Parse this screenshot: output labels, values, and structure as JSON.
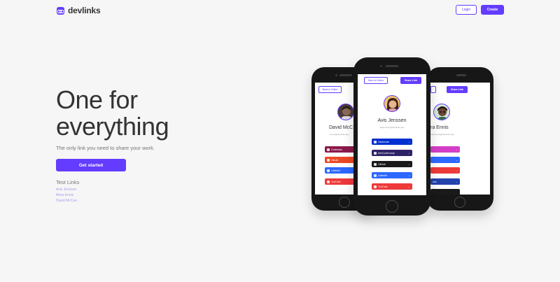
{
  "header": {
    "logo_text": "devlinks",
    "login_label": "Login",
    "create_label": "Create"
  },
  "hero": {
    "title": "One for everything",
    "subtitle": "The only link you need to share your work.",
    "cta_label": "Get started"
  },
  "test_links": {
    "title": "Test Links",
    "items": [
      "Avis Jenssen",
      "Mara Ennis",
      "David McCoe"
    ]
  },
  "phones": {
    "left": {
      "back_label": "Back to Editor",
      "name": "David McC",
      "email": "mccoe@devlinks.app",
      "links": [
        {
          "label": "Codewars",
          "color": "#8a1a4b"
        },
        {
          "label": "GitLab",
          "color": "#eb4925"
        },
        {
          "label": "LinkedIn",
          "color": "#2d68ff"
        },
        {
          "label": "YouTube",
          "color": "#ee3939"
        }
      ]
    },
    "center": {
      "back_label": "Back to Editor",
      "share_label": "Share Link",
      "name": "Avis Jenssen",
      "email": "avisjenssen@devlinks.app",
      "links": [
        {
          "label": "Hashnode",
          "color": "#0330d1"
        },
        {
          "label": "freeCodeCamp",
          "color": "#302267"
        },
        {
          "label": "GitHub",
          "color": "#1a1a1a"
        },
        {
          "label": "LinkedIn",
          "color": "#2d68ff"
        },
        {
          "label": "YouTube",
          "color": "#ee3939"
        }
      ]
    },
    "right": {
      "share_label": "Share Link",
      "name": "ra Ennis",
      "email": "maraennis@devlinks.app",
      "links": [
        {
          "label": "",
          "color": "#d43ec7"
        },
        {
          "label": "",
          "color": "#2d68ff"
        },
        {
          "label": "",
          "color": "#ee3939"
        },
        {
          "label": "ook",
          "color": "#2442ac"
        },
        {
          "label": "",
          "color": "#1a1a1a"
        }
      ]
    }
  },
  "colors": {
    "accent": "#633cff",
    "background": "#f6f6f7",
    "text": "#333333",
    "muted": "#737373"
  }
}
